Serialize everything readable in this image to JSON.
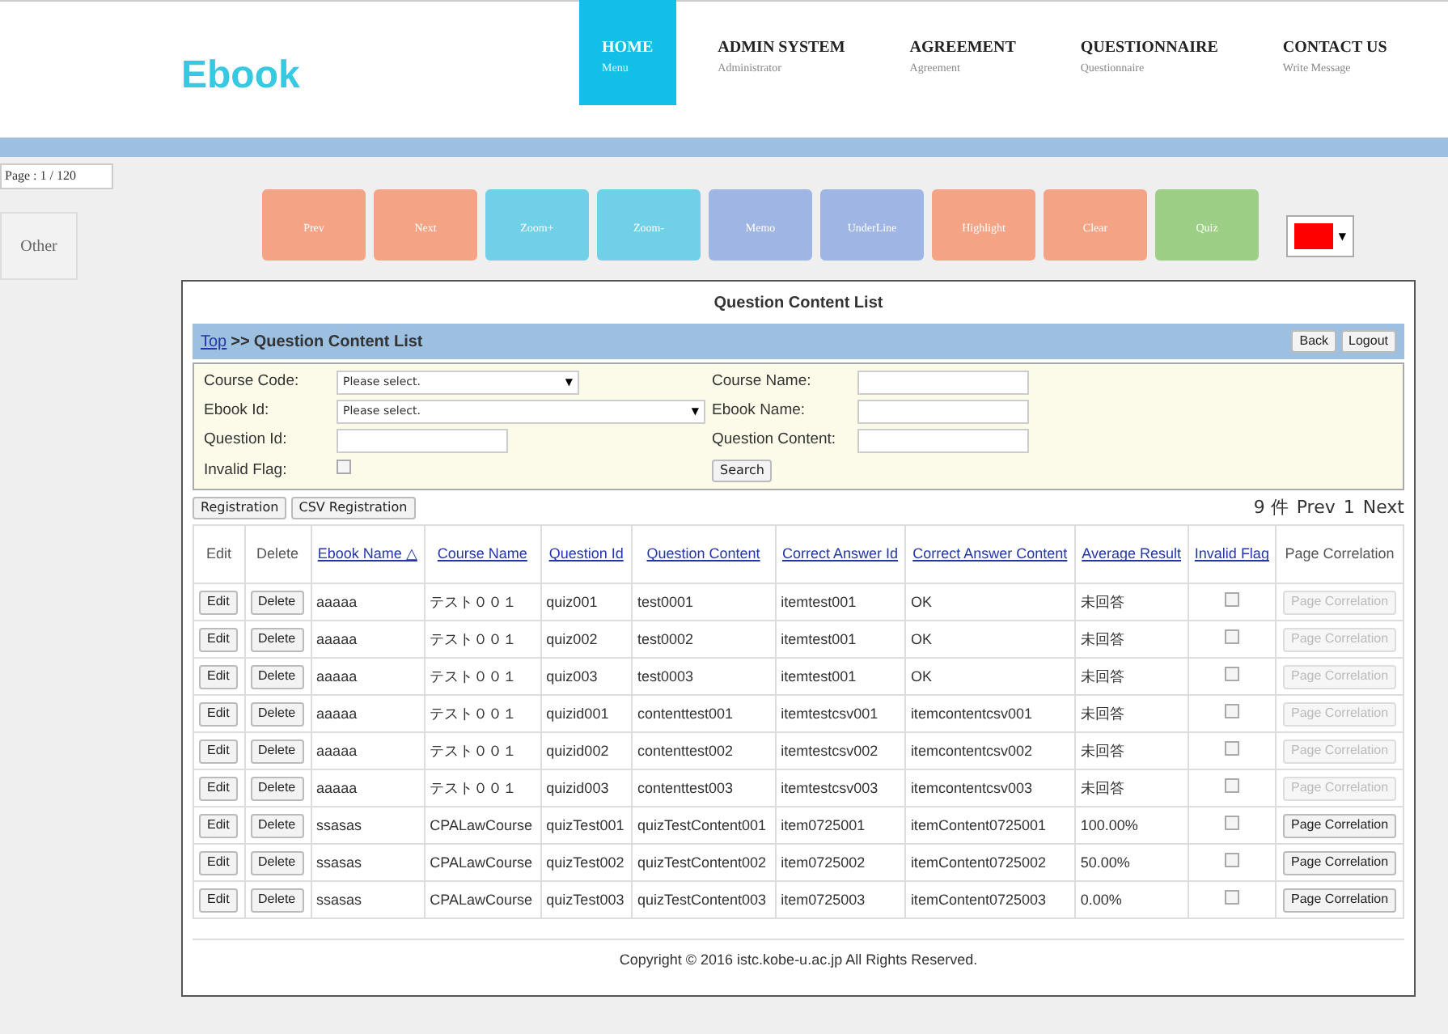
{
  "logo": "Ebook",
  "nav": [
    {
      "title": "HOME",
      "subtitle": "Menu",
      "selected": true
    },
    {
      "title": "ADMIN SYSTEM",
      "subtitle": "Administrator",
      "selected": false
    },
    {
      "title": "AGREEMENT",
      "subtitle": "Agreement",
      "selected": false
    },
    {
      "title": "QUESTIONNAIRE",
      "subtitle": "Questionnaire",
      "selected": false
    },
    {
      "title": "CONTACT US",
      "subtitle": "Write Message",
      "selected": false
    }
  ],
  "page_indicator": "Page : 1 / 120",
  "side_tab": "Other",
  "toolbar": [
    {
      "label": "Prev",
      "color": "#f4a384"
    },
    {
      "label": "Next",
      "color": "#f4a384"
    },
    {
      "label": "Zoom+",
      "color": "#6fd0e8"
    },
    {
      "label": "Zoom-",
      "color": "#6fd0e8"
    },
    {
      "label": "Memo",
      "color": "#9fb5e3"
    },
    {
      "label": "UnderLine",
      "color": "#9fb5e3"
    },
    {
      "label": "Highlight",
      "color": "#f4a384"
    },
    {
      "label": "Clear",
      "color": "#f4a384"
    },
    {
      "label": "Quiz",
      "color": "#9ccf85"
    }
  ],
  "color_picker": {
    "color": "#ff0000",
    "caret": "▼"
  },
  "panel_title": "Question Content List",
  "breadcrumb": {
    "link": "Top",
    "separator": ">>",
    "current": "Question Content List"
  },
  "header_buttons": [
    "Back",
    "Logout"
  ],
  "search_form": {
    "fields": [
      {
        "kind": "select",
        "label": "Course Code:",
        "value": "Please select.",
        "caret": "▼"
      },
      {
        "kind": "text",
        "label": "Course Name:"
      },
      {
        "kind": "select",
        "label": "Ebook Id:",
        "value": "Please select.",
        "caret": "▼"
      },
      {
        "kind": "text",
        "label": "Ebook Name:"
      },
      {
        "kind": "text",
        "label": "Question Id:"
      },
      {
        "kind": "text",
        "label": "Question Content:"
      },
      {
        "kind": "checkbox",
        "label": "Invalid Flag:",
        "checked": false
      }
    ],
    "search_button": "Search"
  },
  "actions": [
    "Registration",
    "CSV Registration"
  ],
  "pager": {
    "count": "9 件",
    "prev": "Prev",
    "page": "1",
    "next": "Next"
  },
  "table": {
    "columns": [
      {
        "label": "Edit",
        "kind": "plain"
      },
      {
        "label": "Delete",
        "kind": "plain"
      },
      {
        "label": "Ebook Name △",
        "kind": "link"
      },
      {
        "label": "Course Name",
        "kind": "link"
      },
      {
        "label": "Question Id",
        "kind": "link"
      },
      {
        "label": "Question Content",
        "kind": "link"
      },
      {
        "label": "Correct Answer Id",
        "kind": "link"
      },
      {
        "label": "Correct Answer Content",
        "kind": "link"
      },
      {
        "label": "Average Result",
        "kind": "link"
      },
      {
        "label": "Invalid Flag",
        "kind": "link"
      },
      {
        "label": "Page Correlation",
        "kind": "plain"
      }
    ],
    "rows": [
      {
        "cells": [
          "Edit",
          "Delete",
          "aaaaa",
          "テスト００１",
          "quiz001",
          "test0001",
          "itemtest001",
          "OK",
          "未回答",
          "",
          "Page Correlation"
        ],
        "invalid": false,
        "correlation_disabled": true
      },
      {
        "cells": [
          "Edit",
          "Delete",
          "aaaaa",
          "テスト００１",
          "quiz002",
          "test0002",
          "itemtest001",
          "OK",
          "未回答",
          "",
          "Page Correlation"
        ],
        "invalid": false,
        "correlation_disabled": true
      },
      {
        "cells": [
          "Edit",
          "Delete",
          "aaaaa",
          "テスト００１",
          "quiz003",
          "test0003",
          "itemtest001",
          "OK",
          "未回答",
          "",
          "Page Correlation"
        ],
        "invalid": false,
        "correlation_disabled": true
      },
      {
        "cells": [
          "Edit",
          "Delete",
          "aaaaa",
          "テスト００１",
          "quizid001",
          "contenttest001",
          "itemtestcsv001",
          "itemcontentcsv001",
          "未回答",
          "",
          "Page Correlation"
        ],
        "invalid": false,
        "correlation_disabled": true
      },
      {
        "cells": [
          "Edit",
          "Delete",
          "aaaaa",
          "テスト００１",
          "quizid002",
          "contenttest002",
          "itemtestcsv002",
          "itemcontentcsv002",
          "未回答",
          "",
          "Page Correlation"
        ],
        "invalid": false,
        "correlation_disabled": true
      },
      {
        "cells": [
          "Edit",
          "Delete",
          "aaaaa",
          "テスト００１",
          "quizid003",
          "contenttest003",
          "itemtestcsv003",
          "itemcontentcsv003",
          "未回答",
          "",
          "Page Correlation"
        ],
        "invalid": false,
        "correlation_disabled": true
      },
      {
        "cells": [
          "Edit",
          "Delete",
          "ssasas",
          "CPALawCourse",
          "quizTest001",
          "quizTestContent001",
          "item0725001",
          "itemContent0725001",
          "100.00%",
          "",
          "Page Correlation"
        ],
        "invalid": false,
        "correlation_disabled": false
      },
      {
        "cells": [
          "Edit",
          "Delete",
          "ssasas",
          "CPALawCourse",
          "quizTest002",
          "quizTestContent002",
          "item0725002",
          "itemContent0725002",
          "50.00%",
          "",
          "Page Correlation"
        ],
        "invalid": false,
        "correlation_disabled": false
      },
      {
        "cells": [
          "Edit",
          "Delete",
          "ssasas",
          "CPALawCourse",
          "quizTest003",
          "quizTestContent003",
          "item0725003",
          "itemContent0725003",
          "0.00%",
          "",
          "Page Correlation"
        ],
        "invalid": false,
        "correlation_disabled": false
      }
    ]
  },
  "footer": "Copyright © 2016 istc.kobe-u.ac.jp All Rights Reserved."
}
